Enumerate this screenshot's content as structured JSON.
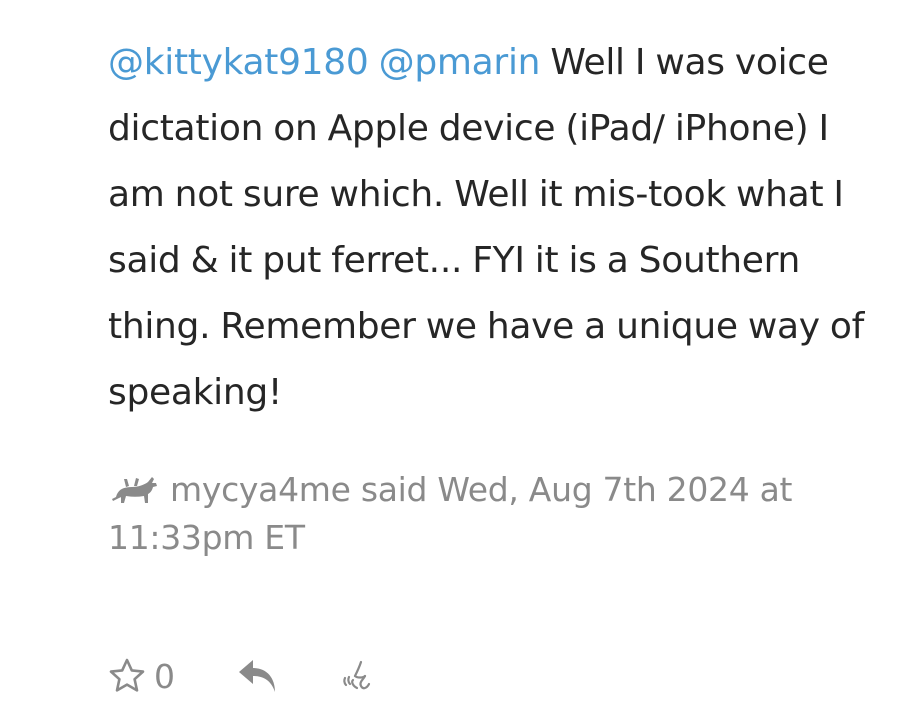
{
  "comment": {
    "mentions": [
      "@kittykat9180",
      "@pmarin"
    ],
    "text_line_1_suffix": "Well I was",
    "text_rest": "voice dictation on Apple device (iPad/ iPhone) I am not sure which. Well it mis-took what I said & it put ferret... FYI it is a Southern thing. Remember we have a unique way of speaking!",
    "author": "mycya4me",
    "said_label": "said",
    "timestamp": "Wed, Aug 7th 2024 at 11:33pm ET",
    "avatar_icon": "cow-icon"
  },
  "actions": {
    "like_icon": "star-outline-icon",
    "like_count": "0",
    "reply_icon": "reply-arrow-icon",
    "react_icon": "react-hand-icon"
  },
  "colors": {
    "mention": "#4a9ad4",
    "body_text": "#262626",
    "meta_text": "#8a8a8a",
    "icon": "#8a8a8a"
  }
}
